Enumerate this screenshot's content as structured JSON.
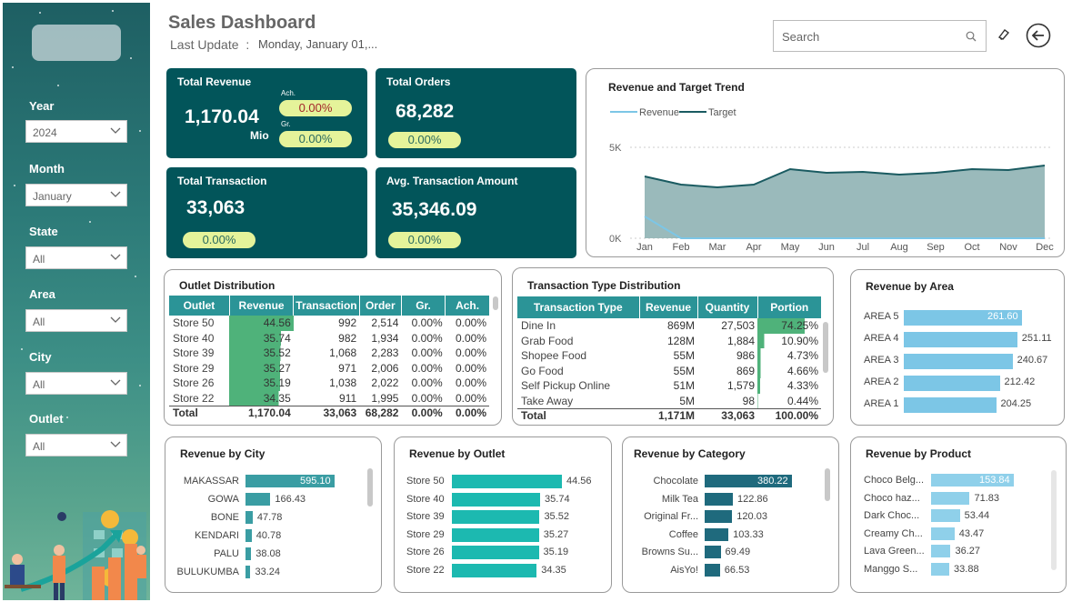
{
  "header": {
    "title": "Sales Dashboard",
    "last_update_label": "Last Update",
    "separator": ":",
    "last_update_value": "Monday, January 01,..."
  },
  "search": {
    "placeholder": "Search"
  },
  "filters": [
    {
      "label": "Year",
      "value": "2024"
    },
    {
      "label": "Month",
      "value": "January"
    },
    {
      "label": "State",
      "value": "All"
    },
    {
      "label": "Area",
      "value": "All"
    },
    {
      "label": "City",
      "value": "All"
    },
    {
      "label": "Outlet",
      "value": "All"
    }
  ],
  "kpis": {
    "revenue": {
      "title": "Total Revenue",
      "value": "1,170.04",
      "unit": "Mio",
      "ach_label": "Ach.",
      "ach": "0.00%",
      "gr_label": "Gr.",
      "gr": "0.00%"
    },
    "orders": {
      "title": "Total Orders",
      "value": "68,282",
      "pct": "0.00%"
    },
    "transaction": {
      "title": "Total Transaction",
      "value": "33,063",
      "pct": "0.00%"
    },
    "avg_amount": {
      "title": "Avg. Transaction Amount",
      "value": "35,346.09",
      "pct": "0.00%"
    }
  },
  "trend": {
    "title": "Revenue and Target Trend",
    "legend": [
      "Revenue",
      "Target"
    ],
    "y_ticks": [
      "5K",
      "0K"
    ],
    "months": [
      "Jan",
      "Feb",
      "Mar",
      "Apr",
      "May",
      "Jun",
      "Jul",
      "Aug",
      "Sep",
      "Oct",
      "Nov",
      "Dec"
    ],
    "colors": {
      "revenue": "#7cc6e6",
      "target": "#1a5b61",
      "area": "#8fb3b4"
    }
  },
  "outlet_dist": {
    "title": "Outlet Distribution",
    "columns": [
      "Outlet",
      "Revenue",
      "Transaction",
      "Order",
      "Gr.",
      "Ach."
    ],
    "rows": [
      [
        "Store 50",
        "44.56",
        "992",
        "2,514",
        "0.00%",
        "0.00%"
      ],
      [
        "Store 40",
        "35.74",
        "982",
        "1,934",
        "0.00%",
        "0.00%"
      ],
      [
        "Store 39",
        "35.52",
        "1,068",
        "2,283",
        "0.00%",
        "0.00%"
      ],
      [
        "Store 29",
        "35.27",
        "971",
        "2,006",
        "0.00%",
        "0.00%"
      ],
      [
        "Store 26",
        "35.19",
        "1,038",
        "2,022",
        "0.00%",
        "0.00%"
      ],
      [
        "Store 22",
        "34.35",
        "911",
        "1,995",
        "0.00%",
        "0.00%"
      ]
    ],
    "revenue_values": [
      44.56,
      35.74,
      35.52,
      35.27,
      35.19,
      34.35
    ],
    "total": [
      "Total",
      "1,170.04",
      "33,063",
      "68,282",
      "0.00%",
      "0.00%"
    ]
  },
  "trans_dist": {
    "title": "Transaction Type Distribution",
    "columns": [
      "Transaction Type",
      "Revenue",
      "Quantity",
      "Portion"
    ],
    "rows": [
      [
        "Dine In",
        "869M",
        "27,503",
        "74.25%"
      ],
      [
        "Grab Food",
        "128M",
        "1,884",
        "10.90%"
      ],
      [
        "Shopee Food",
        "55M",
        "986",
        "4.73%"
      ],
      [
        "Go Food",
        "55M",
        "869",
        "4.66%"
      ],
      [
        "Self Pickup Online",
        "51M",
        "1,579",
        "4.33%"
      ],
      [
        "Take Away",
        "5M",
        "98",
        "0.44%"
      ]
    ],
    "portion_values": [
      74.25,
      10.9,
      4.73,
      4.66,
      4.33,
      0.44
    ],
    "total": [
      "Total",
      "1,171M",
      "33,063",
      "100.00%"
    ]
  },
  "area": {
    "title": "Revenue by Area",
    "labels": [
      "AREA 5",
      "AREA 4",
      "AREA 3",
      "AREA 2",
      "AREA 1"
    ],
    "values": [
      "261.60",
      "251.11",
      "240.67",
      "212.42",
      "204.25"
    ],
    "nums": [
      261.6,
      251.11,
      240.67,
      212.42,
      204.25
    ],
    "color": "#7cc6e6"
  },
  "city": {
    "title": "Revenue by City",
    "labels": [
      "MAKASSAR",
      "GOWA",
      "BONE",
      "KENDARI",
      "PALU",
      "BULUKUMBA"
    ],
    "values": [
      "595.10",
      "166.43",
      "47.78",
      "40.78",
      "38.08",
      "33.24"
    ],
    "nums": [
      595.1,
      166.43,
      47.78,
      40.78,
      38.08,
      33.24
    ],
    "color": "#3a9da3"
  },
  "outlet": {
    "title": "Revenue by Outlet",
    "labels": [
      "Store 50",
      "Store 40",
      "Store 39",
      "Store 29",
      "Store 26",
      "Store 22"
    ],
    "values": [
      "44.56",
      "35.74",
      "35.52",
      "35.27",
      "35.19",
      "34.35"
    ],
    "nums": [
      44.56,
      35.74,
      35.52,
      35.27,
      35.19,
      34.35
    ],
    "color": "#1cb9b0"
  },
  "category": {
    "title": "Revenue by Category",
    "labels": [
      "Chocolate",
      "Milk Tea",
      "Original Fr...",
      "Coffee",
      "Browns Su...",
      "AisYo!"
    ],
    "values": [
      "380.22",
      "122.86",
      "120.03",
      "103.33",
      "69.49",
      "66.53"
    ],
    "nums": [
      380.22,
      122.86,
      120.03,
      103.33,
      69.49,
      66.53
    ],
    "color": "#1f6a7d"
  },
  "product": {
    "title": "Revenue by Product",
    "labels": [
      "Choco Belg...",
      "Choco haz...",
      "Dark Choc...",
      "Creamy Ch...",
      "Lava Green...",
      "Manggo S..."
    ],
    "values": [
      "153.84",
      "71.83",
      "53.44",
      "43.47",
      "36.27",
      "33.88"
    ],
    "nums": [
      153.84,
      71.83,
      53.44,
      43.47,
      36.27,
      33.88
    ],
    "color": "#8fd0ea"
  }
}
